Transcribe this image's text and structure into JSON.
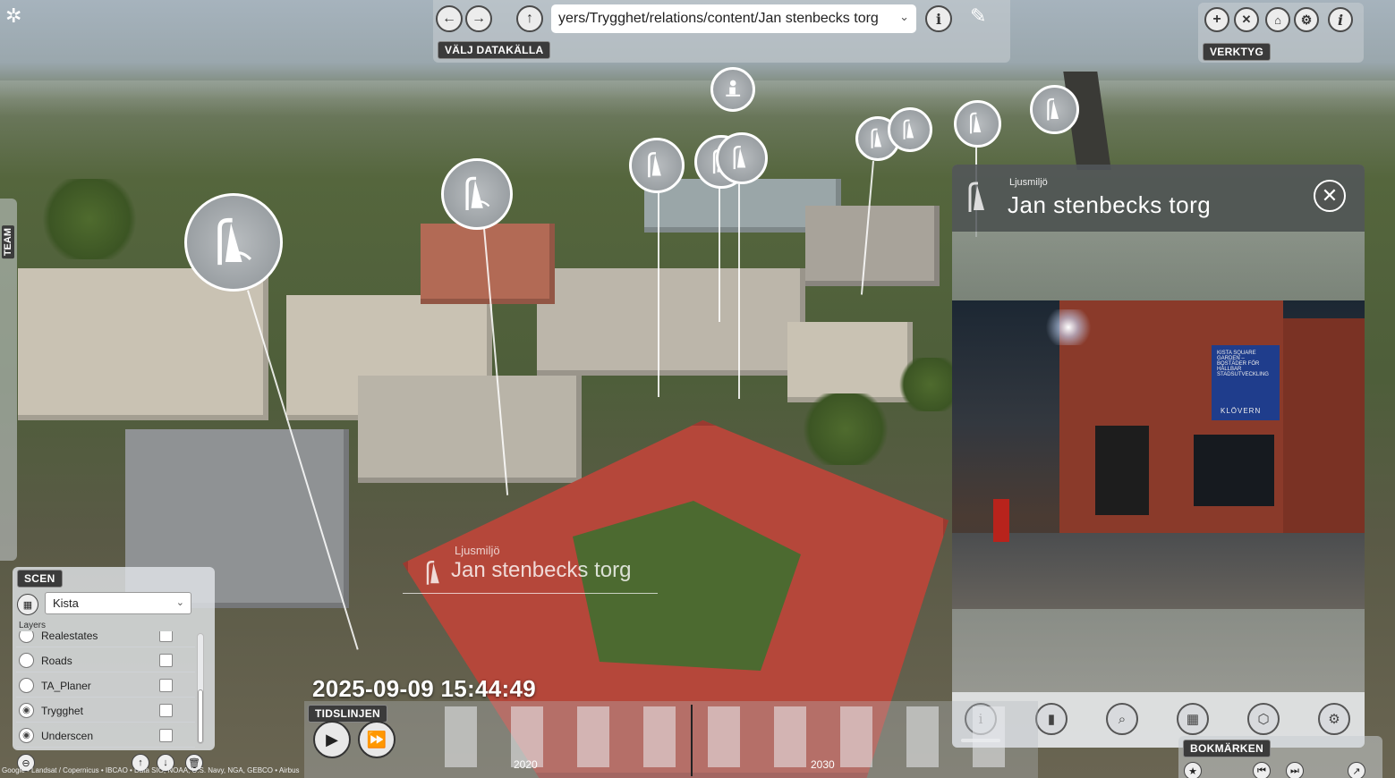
{
  "colors": {
    "panel_bg": "#c8cdd2",
    "tag_bg": "#3b3b3b",
    "accent_white": "#ffffff",
    "roof_red": "#b5473a"
  },
  "toolbar": {
    "url": "yers/Trygghet/relations/content/Jan stenbecks torg",
    "datasource_label": "VÄLJ DATAKÄLLA",
    "back_icon": "arrow-left-icon",
    "forward_icon": "arrow-right-icon",
    "up_icon": "arrow-up-icon",
    "info_icon": "info-icon",
    "feather_icon": "feather-icon"
  },
  "tools": {
    "label": "VERKTYG",
    "icons": [
      "plus-icon",
      "collapse-icon",
      "home-icon",
      "gear-icon",
      "info-icon"
    ]
  },
  "team_tab": {
    "label": "TEAM"
  },
  "scen": {
    "label": "SCEN",
    "selected": "Kista",
    "layers_label": "Layers",
    "layers": [
      {
        "name": "Realestates",
        "visible": false
      },
      {
        "name": "Roads",
        "visible": false
      },
      {
        "name": "TA_Planer",
        "visible": false
      },
      {
        "name": "Trygghet",
        "visible": true
      },
      {
        "name": "Underscen",
        "visible": true
      }
    ]
  },
  "overlay": {
    "category": "Ljusmiljö",
    "title": "Jan stenbecks torg"
  },
  "info": {
    "category": "Ljusmiljö",
    "title": "Jan stenbecks torg",
    "close_icon": "close-icon",
    "billboard_text": "KISTA SQUARE GARDEN – BOSTÄDER FÖR HÅLLBAR STADSUTVECKLING",
    "billboard_brand": "KLÖVERN",
    "toolbar_icons": [
      "info-icon",
      "chart-icon",
      "search-chat-icon",
      "calendar-icon",
      "cube-icon",
      "gear-icon"
    ]
  },
  "timeline": {
    "datetime": "2025-09-09 15:44:49",
    "label": "TIDSLINJEN",
    "years": [
      "2020",
      "2030"
    ]
  },
  "bookmarks": {
    "label": "BOKMÄRKEN"
  },
  "attribution": "Google  •  Landsat / Copernicus  •  IBCAO  •  Data SIO, NOAA, U.S. Navy, NGA, GEBCO  •  Airbus"
}
